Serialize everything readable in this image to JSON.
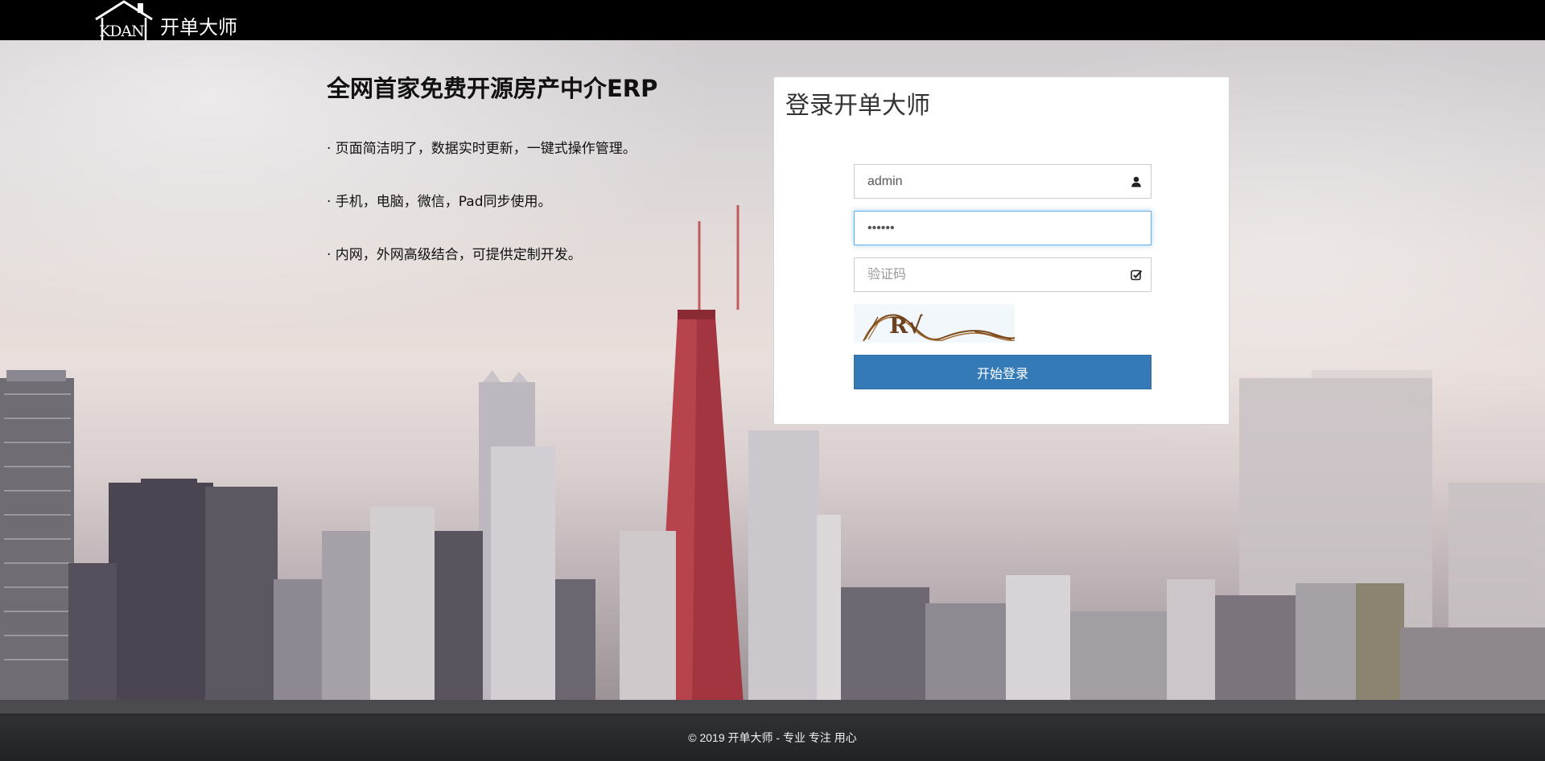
{
  "brand": {
    "logo_letters": "KDAN",
    "name": "开单大师"
  },
  "intro": {
    "title": "全网首家免费开源房产中介ERP",
    "points": [
      "· 页面简洁明了，数据实时更新，一键式操作管理。",
      "· 手机，电脑，微信，Pad同步使用。",
      "· 内网，外网高级结合，可提供定制开发。"
    ]
  },
  "login": {
    "title": "登录开单大师",
    "username": {
      "value": "admin",
      "icon": "user-icon"
    },
    "password": {
      "value": "123456",
      "icon": "none"
    },
    "captcha_input": {
      "value": "",
      "placeholder": "验证码",
      "icon": "check-square-icon"
    },
    "captcha_text": "R√",
    "submit_label": "开始登录",
    "accent_color": "#337ab7"
  },
  "footer": {
    "text": "© 2019 开单大师 - 专业 专注 用心"
  }
}
